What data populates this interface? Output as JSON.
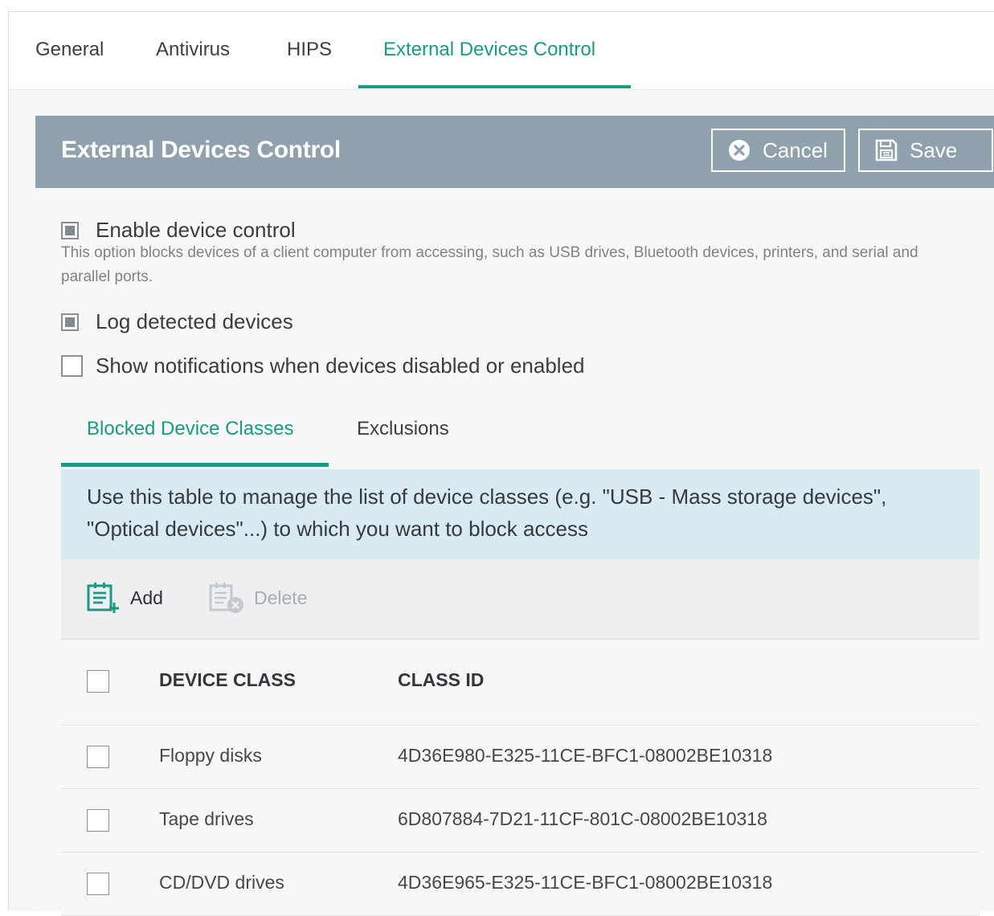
{
  "top_tabs": [
    {
      "label": "General",
      "active": false
    },
    {
      "label": "Antivirus",
      "active": false
    },
    {
      "label": "HIPS",
      "active": false
    },
    {
      "label": "External Devices Control",
      "active": true
    }
  ],
  "panel": {
    "title": "External Devices Control",
    "cancel_label": "Cancel",
    "save_label": "Save"
  },
  "options": {
    "enable_device_control": {
      "label": "Enable device control",
      "checked": true,
      "description": "This option blocks devices of a client computer from accessing, such as USB drives, Bluetooth devices, printers, and serial and parallel ports."
    },
    "log_detected_devices": {
      "label": "Log detected devices",
      "checked": true
    },
    "show_notifications": {
      "label": "Show notifications when devices disabled or enabled",
      "checked": false
    }
  },
  "inner_tabs": [
    {
      "label": "Blocked Device Classes",
      "active": true
    },
    {
      "label": "Exclusions",
      "active": false
    }
  ],
  "info_text": "Use this table to manage the list of device classes (e.g. \"USB - Mass storage devices\", \"Optical devices\"...) to which you want to block access",
  "toolbar": {
    "add_label": "Add",
    "delete_label": "Delete",
    "delete_enabled": false
  },
  "table": {
    "columns": [
      "DEVICE CLASS",
      "CLASS ID"
    ],
    "rows": [
      {
        "device_class": "Floppy disks",
        "class_id": "4D36E980-E325-11CE-BFC1-08002BE10318"
      },
      {
        "device_class": "Tape drives",
        "class_id": "6D807884-7D21-11CF-801C-08002BE10318"
      },
      {
        "device_class": "CD/DVD drives",
        "class_id": "4D36E965-E325-11CE-BFC1-08002BE10318"
      }
    ]
  },
  "colors": {
    "accent": "#1a9a83",
    "header_bar": "#8ea1ad",
    "info_background": "#d8eaf2"
  }
}
